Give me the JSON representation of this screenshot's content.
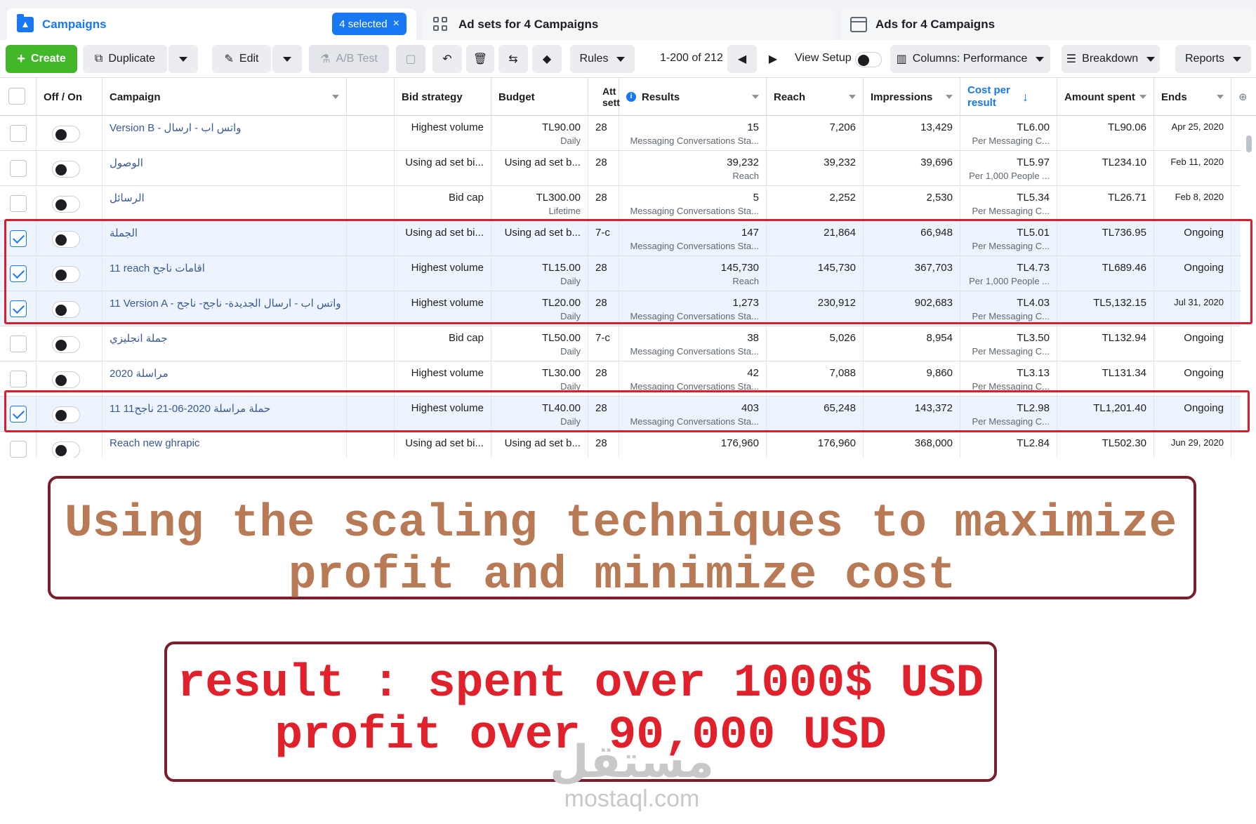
{
  "tabs": {
    "campaigns": "Campaigns",
    "selected": "4 selected",
    "selected_close": "×",
    "adsets": "Ad sets for 4 Campaigns",
    "ads": "Ads for 4 Campaigns"
  },
  "toolbar": {
    "create": "Create",
    "duplicate": "Duplicate",
    "edit": "Edit",
    "ab_test": "A/B Test",
    "rules": "Rules",
    "pagination": "1-200 of 212",
    "view_setup": "View Setup",
    "columns": "Columns: Performance",
    "breakdown": "Breakdown",
    "reports": "Reports"
  },
  "columns": {
    "off_on": "Off / On",
    "campaign": "Campaign",
    "bid_strategy": "Bid strategy",
    "budget": "Budget",
    "attribution": "Att sett",
    "results": "Results",
    "reach": "Reach",
    "impressions": "Impressions",
    "cost_per_result": "Cost per result",
    "amount_spent": "Amount spent",
    "ends": "Ends"
  },
  "rows": [
    {
      "campaign": "Version B - واتس اب - ارسال",
      "bid": "Highest volume",
      "budget": "TL90.00",
      "budget_sub": "Daily",
      "att": "28",
      "results": "15",
      "results_sub": "Messaging Conversations Sta...",
      "reach": "7,206",
      "impressions": "13,429",
      "cpr": "TL6.00",
      "cpr_sub": "Per Messaging C...",
      "spent": "TL90.06",
      "ends": "Apr 25, 2020",
      "selected": false
    },
    {
      "campaign": "الوصول",
      "bid": "Using ad set bi...",
      "budget": "Using ad set b...",
      "budget_sub": "",
      "att": "28",
      "results": "39,232",
      "results_sub": "Reach",
      "reach": "39,232",
      "impressions": "39,696",
      "cpr": "TL5.97",
      "cpr_sub": "Per 1,000 People ...",
      "spent": "TL234.10",
      "ends": "Feb 11, 2020",
      "selected": false
    },
    {
      "campaign": "الرسائل",
      "bid": "Bid cap",
      "budget": "TL300.00",
      "budget_sub": "Lifetime",
      "att": "28",
      "results": "5",
      "results_sub": "Messaging Conversations Sta...",
      "reach": "2,252",
      "impressions": "2,530",
      "cpr": "TL5.34",
      "cpr_sub": "Per Messaging C...",
      "spent": "TL26.71",
      "ends": "Feb 8, 2020",
      "selected": false
    },
    {
      "campaign": "الجملة",
      "bid": "Using ad set bi...",
      "budget": "Using ad set b...",
      "budget_sub": "",
      "att": "7-c",
      "results": "147",
      "results_sub": "Messaging Conversations Sta...",
      "reach": "21,864",
      "impressions": "66,948",
      "cpr": "TL5.01",
      "cpr_sub": "Per Messaging C...",
      "spent": "TL736.95",
      "ends": "Ongoing",
      "selected": true
    },
    {
      "campaign": "11 reach اقامات ناجح",
      "bid": "Highest volume",
      "budget": "TL15.00",
      "budget_sub": "Daily",
      "att": "28",
      "results": "145,730",
      "results_sub": "Reach",
      "reach": "145,730",
      "impressions": "367,703",
      "cpr": "TL4.73",
      "cpr_sub": "Per 1,000 People ...",
      "spent": "TL689.46",
      "ends": "Ongoing",
      "selected": true
    },
    {
      "campaign": "11 Version A - واتس اب - ارسال الجديدة- ناجح- ناجح",
      "bid": "Highest volume",
      "budget": "TL20.00",
      "budget_sub": "Daily",
      "att": "28",
      "results": "1,273",
      "results_sub": "Messaging Conversations Sta...",
      "reach": "230,912",
      "impressions": "902,683",
      "cpr": "TL4.03",
      "cpr_sub": "Per Messaging C...",
      "spent": "TL5,132.15",
      "ends": "Jul 31, 2020",
      "selected": true
    },
    {
      "campaign": "جملة انجليزي",
      "bid": "Bid cap",
      "budget": "TL50.00",
      "budget_sub": "Daily",
      "att": "7-c",
      "results": "38",
      "results_sub": "Messaging Conversations Sta...",
      "reach": "5,026",
      "impressions": "8,954",
      "cpr": "TL3.50",
      "cpr_sub": "Per Messaging C...",
      "spent": "TL132.94",
      "ends": "Ongoing",
      "selected": false
    },
    {
      "campaign": "مراسلة 2020",
      "bid": "Highest volume",
      "budget": "TL30.00",
      "budget_sub": "Daily",
      "att": "28",
      "results": "42",
      "results_sub": "Messaging Conversations Sta...",
      "reach": "7,088",
      "impressions": "9,860",
      "cpr": "TL3.13",
      "cpr_sub": "Per Messaging C...",
      "spent": "TL131.34",
      "ends": "Ongoing",
      "selected": false
    },
    {
      "campaign": "11 حملة مراسلة 2020-06-21 ناجح11",
      "bid": "Highest volume",
      "budget": "TL40.00",
      "budget_sub": "Daily",
      "att": "28",
      "results": "403",
      "results_sub": "Messaging Conversations Sta...",
      "reach": "65,248",
      "impressions": "143,372",
      "cpr": "TL2.98",
      "cpr_sub": "Per Messaging C...",
      "spent": "TL1,201.40",
      "ends": "Ongoing",
      "selected": true
    },
    {
      "campaign": "Reach new ghrapic",
      "bid": "Using ad set bi...",
      "budget": "Using ad set b...",
      "budget_sub": "",
      "att": "28",
      "results": "176,960",
      "results_sub": "",
      "reach": "176,960",
      "impressions": "368,000",
      "cpr": "TL2.84",
      "cpr_sub": "",
      "spent": "TL502.30",
      "ends": "Jun 29, 2020",
      "selected": false
    }
  ],
  "callout1": {
    "line1": "Using the scaling techniques to maximize",
    "line2": "profit and minimize cost"
  },
  "callout2": {
    "line1": "result : spent over 1000$ USD",
    "line2": "profit over 90,000  USD"
  },
  "watermark": {
    "arabic": "مستقل",
    "latin": "mostaql.com"
  },
  "colors": {
    "accent": "#1877f2",
    "create_green": "#42b72a",
    "highlight_red": "#d62030",
    "callout1_text": "#b87a55",
    "callout2_text": "#e0202a",
    "callout_border": "#7a1d2c"
  }
}
